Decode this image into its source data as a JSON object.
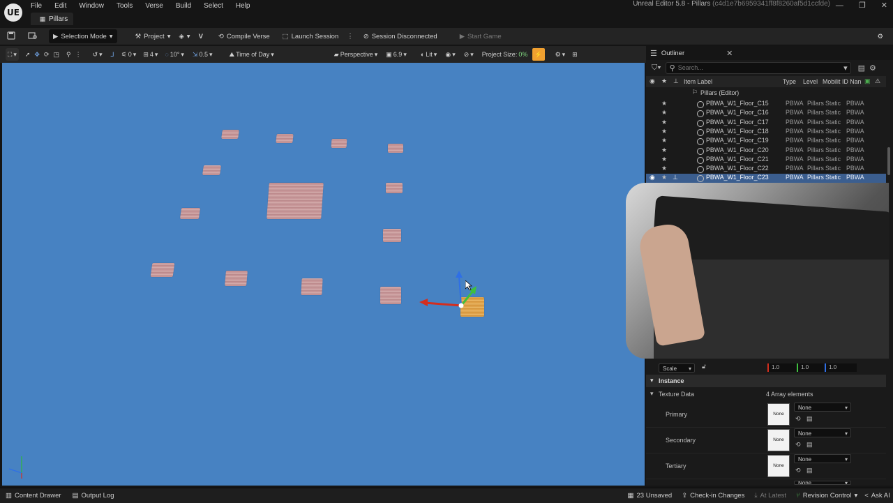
{
  "app": {
    "title": "Unreal Editor 5.8 - Pillars",
    "hash": "(c4d1e7b6959341ff8f8260af5d1ccfde)",
    "logo": "UE"
  },
  "menu": [
    "File",
    "Edit",
    "Window",
    "Tools",
    "Verse",
    "Build",
    "Select",
    "Help"
  ],
  "doc_tab": "Pillars",
  "toolbar": {
    "selection_mode": "Selection Mode",
    "project": "Project",
    "compile_verse": "Compile Verse",
    "launch_session": "Launch Session",
    "session_status": "Session Disconnected",
    "start_game": "Start Game"
  },
  "viewport_toolbar": {
    "translate_snap": "0",
    "grid_snap": "4",
    "rotation_snap": "10°",
    "scale_snap": "0.5",
    "time_of_day": "Time of Day",
    "perspective": "Perspective",
    "camera_speed": "6.9",
    "view_mode": "Lit",
    "project_size_label": "Project Size:",
    "project_size_value": "0%"
  },
  "outliner": {
    "tab_title": "Outliner",
    "search_placeholder": "Search...",
    "columns": {
      "item_label": "Item Label",
      "type": "Type",
      "level": "Level",
      "mobility": "Mobilit",
      "id_name": "ID Nan"
    },
    "root": "Pillars (Editor)",
    "rows": [
      {
        "label": "PBWA_W1_Floor_C15",
        "type": "PBWA",
        "level": "Pillars",
        "mobility": "Static",
        "id": "PBWA",
        "selected": false
      },
      {
        "label": "PBWA_W1_Floor_C16",
        "type": "PBWA",
        "level": "Pillars",
        "mobility": "Static",
        "id": "PBWA",
        "selected": false
      },
      {
        "label": "PBWA_W1_Floor_C17",
        "type": "PBWA",
        "level": "Pillars",
        "mobility": "Static",
        "id": "PBWA",
        "selected": false
      },
      {
        "label": "PBWA_W1_Floor_C18",
        "type": "PBWA",
        "level": "Pillars",
        "mobility": "Static",
        "id": "PBWA",
        "selected": false
      },
      {
        "label": "PBWA_W1_Floor_C19",
        "type": "PBWA",
        "level": "Pillars",
        "mobility": "Static",
        "id": "PBWA",
        "selected": false
      },
      {
        "label": "PBWA_W1_Floor_C20",
        "type": "PBWA",
        "level": "Pillars",
        "mobility": "Static",
        "id": "PBWA",
        "selected": false
      },
      {
        "label": "PBWA_W1_Floor_C21",
        "type": "PBWA",
        "level": "Pillars",
        "mobility": "Static",
        "id": "PBWA",
        "selected": false
      },
      {
        "label": "PBWA_W1_Floor_C22",
        "type": "PBWA",
        "level": "Pillars",
        "mobility": "Static",
        "id": "PBWA",
        "selected": false
      },
      {
        "label": "PBWA_W1_Floor_C23",
        "type": "PBWA",
        "level": "Pillars",
        "mobility": "Static",
        "id": "PBWA",
        "selected": true
      }
    ]
  },
  "details": {
    "scale_label": "Scale",
    "scale_x": "1.0",
    "scale_y": "1.0",
    "scale_z": "1.0",
    "instance_section": "Instance",
    "texture_data": "Texture Data",
    "array_elements": "4 Array elements",
    "slots": [
      {
        "name": "Primary",
        "thumb": "None",
        "value": "None"
      },
      {
        "name": "Secondary",
        "thumb": "None",
        "value": "None"
      },
      {
        "name": "Tertiary",
        "thumb": "None",
        "value": "None"
      }
    ],
    "partial_value": "None"
  },
  "statusbar": {
    "content_drawer": "Content Drawer",
    "output_log": "Output Log",
    "unsaved": "23 Unsaved",
    "check_in": "Check-in Changes",
    "at_latest": "At Latest",
    "revision_control": "Revision Control",
    "ask_ai": "Ask AI"
  },
  "colors": {
    "viewport_bg": "#4782c2",
    "selection": "#3b5e8f",
    "accent_orange": "#f0a030"
  }
}
